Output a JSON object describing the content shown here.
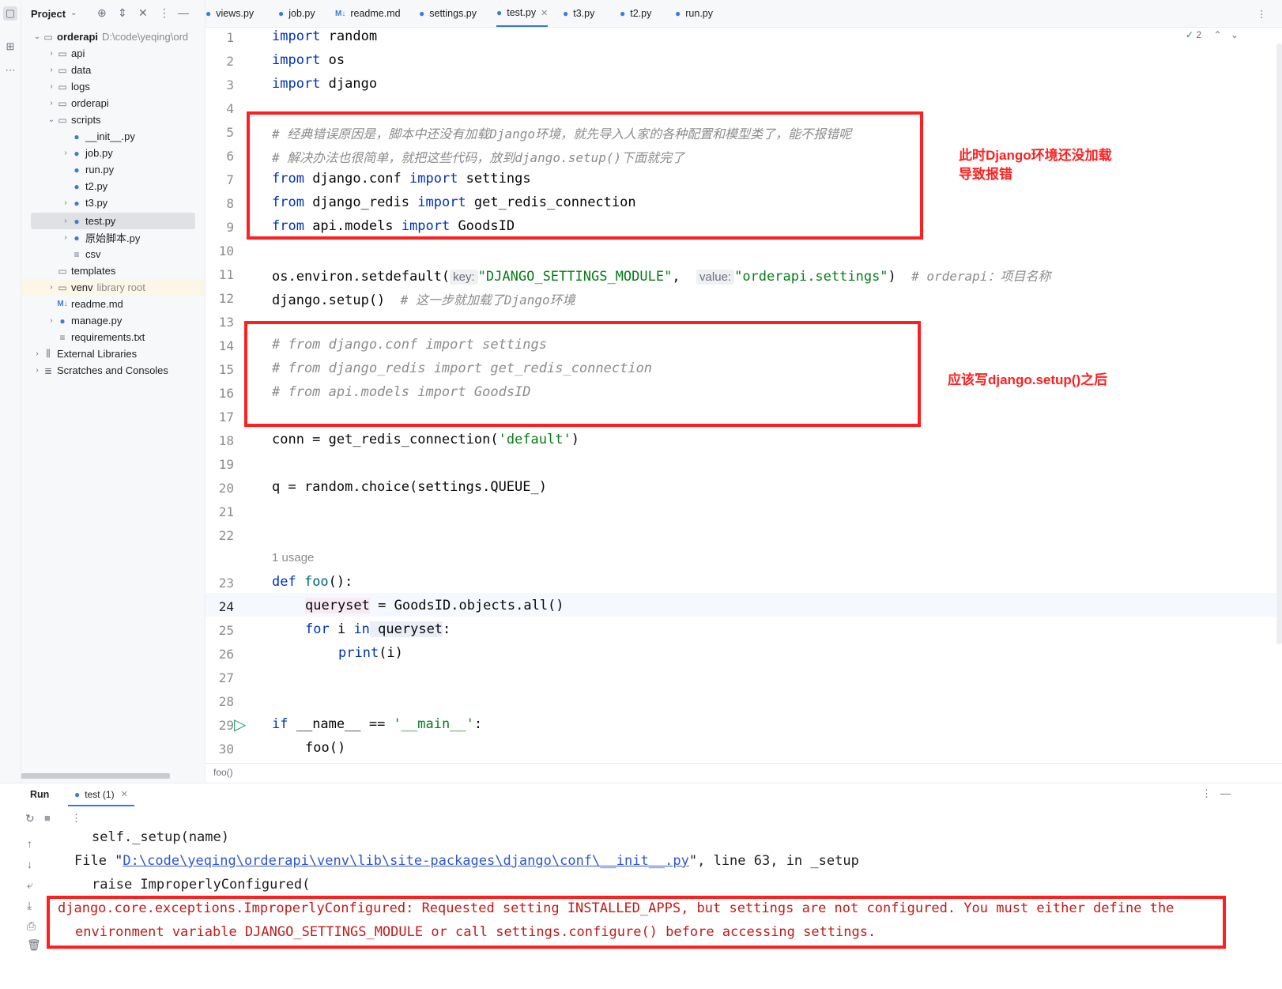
{
  "project_panel": {
    "title": "Project",
    "root": {
      "name": "orderapi",
      "path": "D:\\code\\yeqing\\ord"
    },
    "items": [
      {
        "label": "api"
      },
      {
        "label": "data"
      },
      {
        "label": "logs"
      },
      {
        "label": "orderapi"
      },
      {
        "label": "scripts"
      },
      {
        "label": "__init__.py"
      },
      {
        "label": "job.py"
      },
      {
        "label": "run.py"
      },
      {
        "label": "t2.py"
      },
      {
        "label": "t3.py"
      },
      {
        "label": "test.py"
      },
      {
        "label": "原始脚本.py"
      },
      {
        "label": "csv"
      },
      {
        "label": "templates"
      },
      {
        "label": "venv",
        "note": "library root"
      },
      {
        "label": "readme.md"
      },
      {
        "label": "manage.py"
      },
      {
        "label": "requirements.txt"
      },
      {
        "label": "External Libraries"
      },
      {
        "label": "Scratches and Consoles"
      }
    ]
  },
  "tabs": [
    {
      "label": "views.py"
    },
    {
      "label": "job.py"
    },
    {
      "label": "readme.md",
      "icon": "M↓"
    },
    {
      "label": "settings.py"
    },
    {
      "label": "test.py",
      "active": true
    },
    {
      "label": "t3.py"
    },
    {
      "label": "t2.py"
    },
    {
      "label": "run.py"
    }
  ],
  "inspection": {
    "count": "2"
  },
  "editor": {
    "line_numbers": [
      "1",
      "2",
      "3",
      "4",
      "5",
      "6",
      "7",
      "8",
      "9",
      "10",
      "11",
      "12",
      "13",
      "14",
      "15",
      "16",
      "17",
      "18",
      "19",
      "20",
      "21",
      "22",
      "23",
      "24",
      "25",
      "26",
      "27",
      "28",
      "29",
      "30"
    ],
    "current_line": "24",
    "lines": {
      "l1": {
        "kw": "import",
        "rest": " random"
      },
      "l2": {
        "kw": "import",
        "rest": " os"
      },
      "l3": {
        "kw": "import",
        "rest": " django"
      },
      "l5": "# 经典错误原因是，脚本中还没有加载Django环境，就先导入人家的各种配置和模型类了，能不报错呢",
      "l6": "# 解决办法也很简单，就把这些代码，放到django.setup()下面就完了",
      "l7": {
        "kw1": "from",
        "mod": " django.conf ",
        "kw2": "import",
        "name": " settings"
      },
      "l8": {
        "kw1": "from",
        "mod": " django_redis ",
        "kw2": "import",
        "name": " get_redis_connection"
      },
      "l9": {
        "kw1": "from",
        "mod": " api.models ",
        "kw2": "import",
        "name": " GoodsID"
      },
      "l11": {
        "call": "os.environ.setdefault(",
        "hint1": "key:",
        "arg1": "\"DJANGO_SETTINGS_MODULE\"",
        "sep": ",  ",
        "hint2": "value:",
        "arg2": "\"orderapi.settings\"",
        "close": ")",
        "comment": "  # orderapi：项目名称"
      },
      "l12": {
        "call": "django.setup()",
        "comment": "  # 这一步就加载了Django环境"
      },
      "l14": "# from django.conf import settings",
      "l15": "# from django_redis import get_redis_connection",
      "l16": "# from api.models import GoodsID",
      "l18": {
        "pre": "conn = get_redis_connection(",
        "str": "'default'",
        "post": ")"
      },
      "l20": "q = random.choice(settings.QUEUE_)",
      "usage": "1 usage",
      "l23": {
        "kw": "def",
        "fn": " foo",
        "rest": "():"
      },
      "l24": {
        "var": "queryset",
        "rest": " = GoodsID.objects.all()"
      },
      "l25": {
        "kw1": "for",
        "mid": " i ",
        "kw2": "in",
        "var": " queryset",
        "rest": ":"
      },
      "l26": {
        "fn": "print",
        "rest": "(i)"
      },
      "l29": {
        "kw": "if",
        "pre": " __name__ == ",
        "str": "'__main__'",
        "post": ":"
      },
      "l30": "foo()"
    },
    "annotation_1": "此时Django环境还没加载\n导致报错",
    "annotation_2": "应该写django.setup()之后",
    "breadcrumb": "foo()"
  },
  "run_panel": {
    "label": "Run",
    "tab": "test (1)",
    "output": {
      "o1": "self._setup(name)",
      "o2_pre": "File \"",
      "o2_link": "D:\\code\\yeqing\\orderapi\\venv\\lib\\site-packages\\django\\conf\\__init__.py",
      "o2_post": "\", line 63, in _setup",
      "o3": "raise ImproperlyConfigured(",
      "o4": "django.core.exceptions.ImproperlyConfigured: Requested setting INSTALLED_APPS, but settings are not configured. You must either define the",
      "o5": "environment variable DJANGO_SETTINGS_MODULE or call settings.configure() before accessing settings."
    }
  },
  "colors": {
    "accent": "#3574f0",
    "annotation_red": "#ff1f1f",
    "keyword": "#0033b3",
    "string": "#067d17",
    "comment": "#8c8c8c",
    "error": "#c21a1a"
  }
}
